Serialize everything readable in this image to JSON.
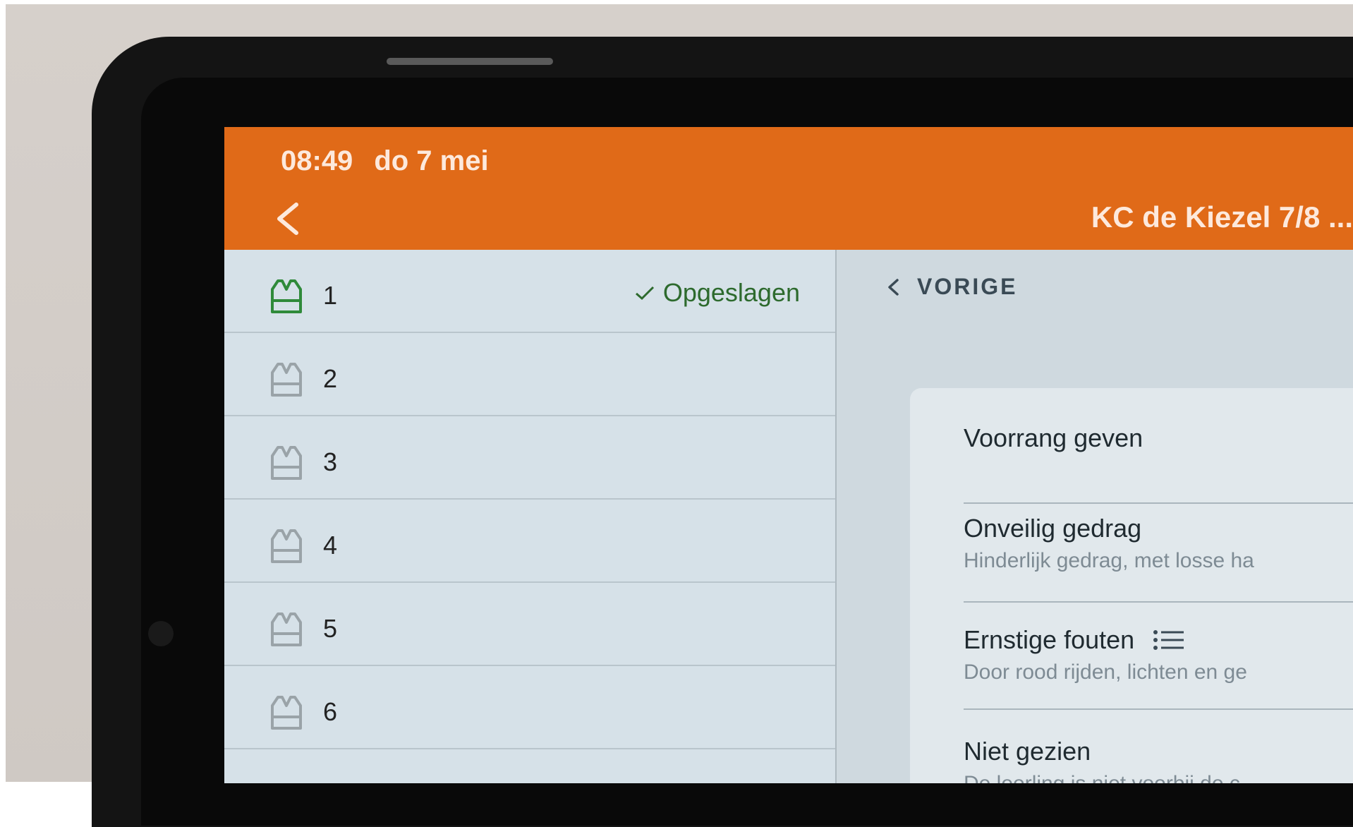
{
  "status_bar": {
    "time": "08:49",
    "date": "do 7 mei"
  },
  "app_bar": {
    "back_icon": "chevron-left-icon",
    "title": "KC de Kiezel 7/8 ..."
  },
  "students": [
    {
      "number": "1",
      "active": true,
      "status": "Opgeslagen"
    },
    {
      "number": "2",
      "active": false
    },
    {
      "number": "3",
      "active": false
    },
    {
      "number": "4",
      "active": false
    },
    {
      "number": "5",
      "active": false
    },
    {
      "number": "6",
      "active": false
    }
  ],
  "detail": {
    "previous_label": "VORIGE",
    "items": [
      {
        "title": "Voorrang geven",
        "subtitle": ""
      },
      {
        "title": "Onveilig gedrag",
        "subtitle": "Hinderlijk gedrag, met losse ha"
      },
      {
        "title": "Ernstige fouten",
        "subtitle": "Door rood rijden, lichten en ge"
      },
      {
        "title": "Niet gezien",
        "subtitle": "De leerling is niet voorbij de c"
      }
    ]
  },
  "colors": {
    "brand_orange": "#e06a18",
    "active_vest": "#2f8a3a",
    "inactive_vest": "#9aa3a8",
    "saved_green": "#2d6a2d"
  }
}
